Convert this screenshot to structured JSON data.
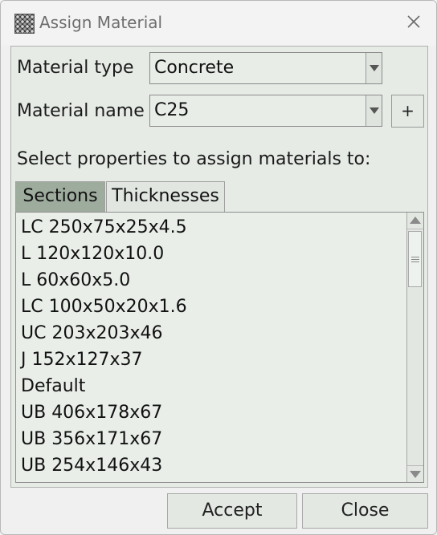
{
  "window": {
    "title": "Assign Material",
    "close_symbol": "✕"
  },
  "form": {
    "material_type_label": "Material type",
    "material_type_value": "Concrete",
    "material_name_label": "Material name",
    "material_name_value": "C25",
    "add_button_label": "+",
    "instruction": "Select properties to assign materials to:"
  },
  "tabs": [
    {
      "label": "Sections",
      "active": true
    },
    {
      "label": "Thicknesses",
      "active": false
    }
  ],
  "list": {
    "items": [
      "LC 250x75x25x4.5",
      "L 120x120x10.0",
      "L 60x60x5.0",
      "LC 100x50x20x1.6",
      "UC 203x203x46",
      "J 152x127x37",
      "Default",
      "UB 406x178x67",
      "UB 356x171x67",
      "UB 254x146x43"
    ]
  },
  "footer": {
    "accept_label": "Accept",
    "close_label": "Close"
  },
  "icons": {
    "app": "material-texture-icon",
    "close": "close-icon",
    "dropdown": "chevron-down-icon",
    "scroll_up": "scroll-up-icon",
    "scroll_down": "scroll-down-icon"
  },
  "colors": {
    "active_tab": "#9eac9e",
    "panel_bg": "#e6ebe6"
  }
}
